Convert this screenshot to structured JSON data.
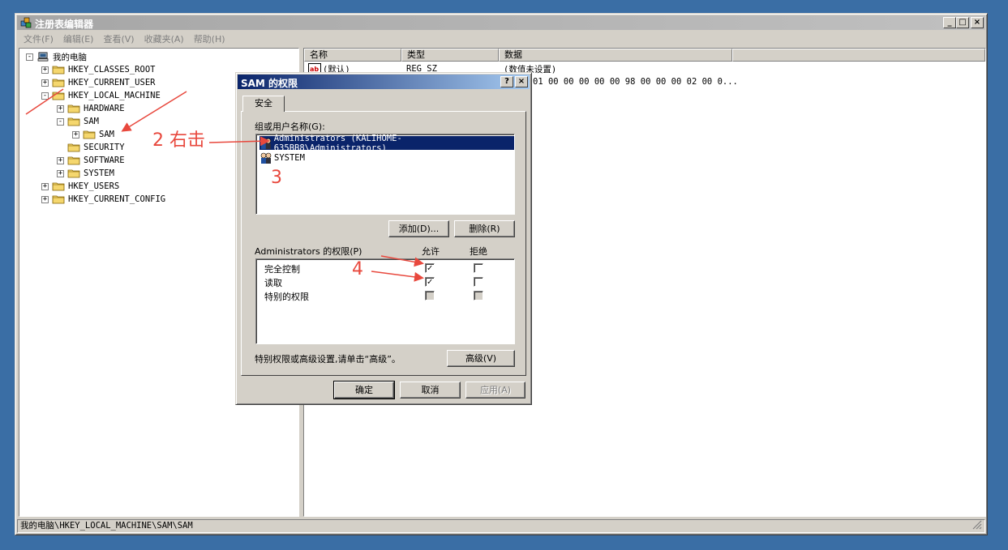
{
  "window": {
    "title": "注册表编辑器"
  },
  "menu": [
    "文件(F)",
    "编辑(E)",
    "查看(V)",
    "收藏夹(A)",
    "帮助(H)"
  ],
  "tree": {
    "root": "我的电脑",
    "items": [
      {
        "label": "HKEY_CLASSES_ROOT",
        "level": 1,
        "expander": "+"
      },
      {
        "label": "HKEY_CURRENT_USER",
        "level": 1,
        "expander": "+"
      },
      {
        "label": "HKEY_LOCAL_MACHINE",
        "level": 1,
        "expander": "-"
      },
      {
        "label": "HARDWARE",
        "level": 2,
        "expander": "+"
      },
      {
        "label": "SAM",
        "level": 2,
        "expander": "-"
      },
      {
        "label": "SAM",
        "level": 3,
        "expander": "+"
      },
      {
        "label": "SECURITY",
        "level": 2,
        "expander": ""
      },
      {
        "label": "SOFTWARE",
        "level": 2,
        "expander": "+"
      },
      {
        "label": "SYSTEM",
        "level": 2,
        "expander": "+"
      },
      {
        "label": "HKEY_USERS",
        "level": 1,
        "expander": "+"
      },
      {
        "label": "HKEY_CURRENT_CONFIG",
        "level": 1,
        "expander": "+"
      }
    ]
  },
  "list": {
    "columns": [
      "名称",
      "类型",
      "数据"
    ],
    "rows": [
      {
        "name": "(默认)",
        "type": "REG_SZ",
        "data": "(数值未设置)"
      },
      {
        "name": "",
        "type": "",
        "data": "01 00 00 00 00 00 98 00 00 00 02 00 0..."
      }
    ]
  },
  "status": "我的电脑\\HKEY_LOCAL_MACHINE\\SAM\\SAM",
  "dialog": {
    "title": "SAM 的权限",
    "help_btn": "?",
    "close_btn": "×",
    "tab": "安全",
    "group_label": "组或用户名称(G):",
    "users": [
      "Administrators (KALIHOME-635BB8\\Administrators)",
      "SYSTEM"
    ],
    "add_btn": "添加(D)...",
    "remove_btn": "删除(R)",
    "perm_label": "Administrators 的权限(P)",
    "allow_header": "允许",
    "deny_header": "拒绝",
    "permissions": [
      {
        "name": "完全控制",
        "allow": true,
        "deny": false,
        "greyed": false
      },
      {
        "name": "读取",
        "allow": true,
        "deny": false,
        "greyed": false
      },
      {
        "name": "特别的权限",
        "allow": false,
        "deny": false,
        "greyed": true
      }
    ],
    "advanced_text": "特别权限或高级设置,请单击“高级”。",
    "advanced_btn": "高级(V)",
    "ok_btn": "确定",
    "cancel_btn": "取消",
    "apply_btn": "应用(A)"
  },
  "annotations": {
    "step2": "2 右击",
    "step3": "3",
    "step4": "4",
    "color": "#e8483d"
  }
}
